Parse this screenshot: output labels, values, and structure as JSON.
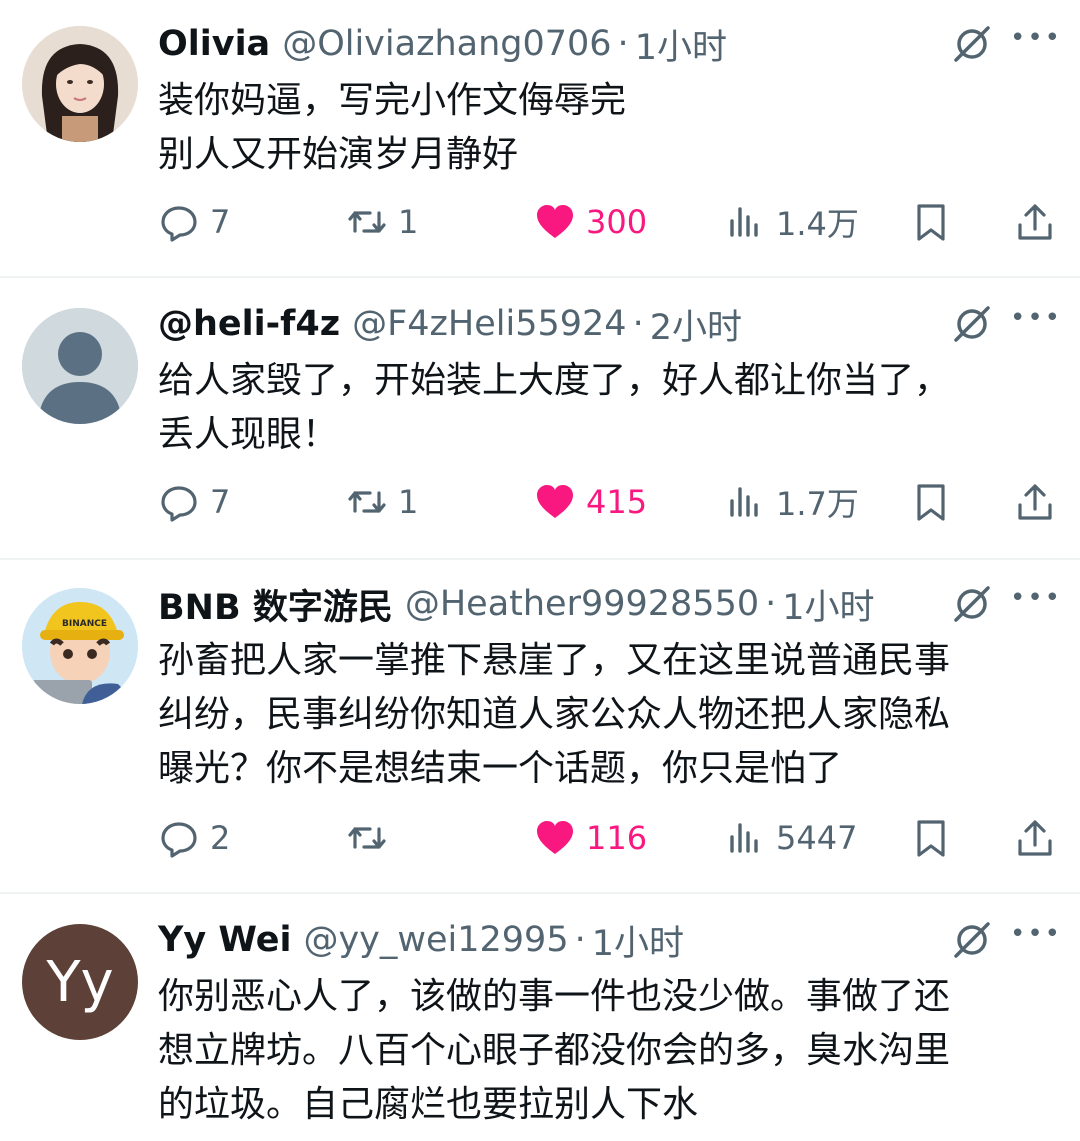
{
  "tweets": [
    {
      "name": "Olivia",
      "handle": "@Oliviazhang0706",
      "separator": "·",
      "time": "1小时",
      "content": "装你妈逼，写完小作文侮辱完\n别人又开始演岁月静好",
      "avatar_type": "photo",
      "counts": {
        "reply": "7",
        "retweet": "1",
        "like": "300",
        "views": "1.4万"
      }
    },
    {
      "name": "@heli-f4z",
      "handle": "@F4zHeli55924",
      "separator": "·",
      "time": "2小时",
      "content": "给人家毁了，开始装上大度了，好人都让你当了，\n丢人现眼！",
      "avatar_type": "default",
      "counts": {
        "reply": "7",
        "retweet": "1",
        "like": "415",
        "views": "1.7万"
      }
    },
    {
      "name": "BNB 数字游民",
      "handle": "@Heather99928550",
      "separator": "·",
      "time": "1小时",
      "content": "孙畜把人家一掌推下悬崖了，又在这里说普通民事\n纠纷，民事纠纷你知道人家公众人物还把人家隐私\n曝光？你不是想结束一个话题，你只是怕了",
      "avatar_type": "cartoon",
      "avatar_text": "BINANCE",
      "counts": {
        "reply": "2",
        "retweet": "",
        "like": "116",
        "views": "5447"
      }
    },
    {
      "name": "Yy Wei",
      "handle": "@yy_wei12995",
      "separator": "·",
      "time": "1小时",
      "content": "你别恶心人了，该做的事一件也没少做。事做了还\n想立牌坊。八百个心眼子都没你会的多，臭水沟里\n的垃圾。自己腐烂也要拉别人下水",
      "avatar_type": "letter",
      "avatar_letter": "Yy"
    }
  ],
  "more_icon": "•••",
  "icons": {
    "reply": "reply-icon",
    "retweet": "retweet-icon",
    "like": "heart-icon",
    "views": "views-icon",
    "bookmark": "bookmark-icon",
    "share": "share-icon",
    "grok": "grok-icon",
    "more": "more-icon"
  },
  "colors": {
    "like": "#f91880",
    "secondary_text": "#536471",
    "text": "#0f1419",
    "divider": "#eff3f4"
  }
}
